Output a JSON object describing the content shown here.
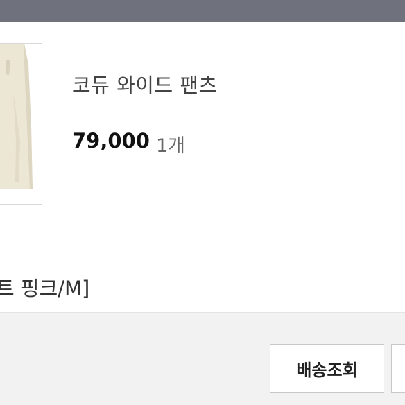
{
  "product": {
    "name": "코듀 와이드 팬츠",
    "price": "79,000",
    "quantity": "1개",
    "thumbnail_icon": "product-thumbnail",
    "thumbnail_color": "#ece6d4"
  },
  "option": {
    "text": "트 핑크/M]"
  },
  "actions": {
    "track_delivery_label": "배송조회",
    "next_button_label": ""
  },
  "colors": {
    "topbar": "#6f717c",
    "footer": "#f2f2f2"
  }
}
